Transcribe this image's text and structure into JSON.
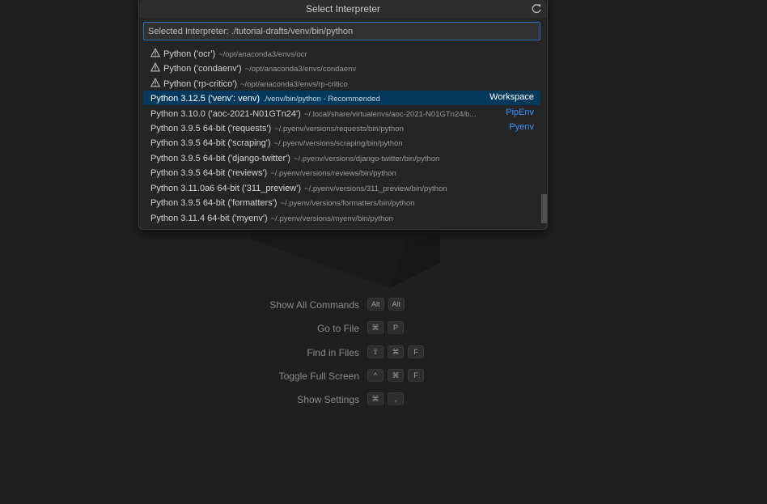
{
  "quick_pick": {
    "title": "Select Interpreter",
    "input_value": "Selected Interpreter: ./tutorial-drafts/venv/bin/python",
    "items": [
      {
        "label": "Python ('ocr')",
        "description": "~/opt/anaconda3/envs/ocr",
        "badge": "",
        "warning": true
      },
      {
        "label": "Python ('condaenv')",
        "description": "~/opt/anaconda3/envs/condaenv",
        "badge": "",
        "warning": true
      },
      {
        "label": "Python ('rp-critico')",
        "description": "~/opt/anaconda3/envs/rp-critico",
        "badge": "",
        "warning": true
      },
      {
        "label": "Python 3.12.5 ('venv': venv)",
        "description": "./venv/bin/python - Recommended",
        "badge": "Workspace",
        "warning": false,
        "selected": true
      },
      {
        "label": "Python 3.10.0 ('aoc-2021-N01GTn24')",
        "description": "~/.local/share/virtualenvs/aoc-2021-N01GTn24/b...",
        "badge": "PipEnv",
        "warning": false
      },
      {
        "label": "Python 3.9.5 64-bit ('requests')",
        "description": "~/.pyenv/versions/requests/bin/python",
        "badge": "Pyenv",
        "warning": false
      },
      {
        "label": "Python 3.9.5 64-bit ('scraping')",
        "description": "~/.pyenv/versions/scraping/bin/python",
        "badge": "",
        "warning": false
      },
      {
        "label": "Python 3.9.5 64-bit ('django-twitter')",
        "description": "~/.pyenv/versions/django-twitter/bin/python",
        "badge": "",
        "warning": false
      },
      {
        "label": "Python 3.9.5 64-bit ('reviews')",
        "description": "~/.pyenv/versions/reviews/bin/python",
        "badge": "",
        "warning": false
      },
      {
        "label": "Python 3.11.0a6 64-bit ('311_preview')",
        "description": "~/.pyenv/versions/311_preview/bin/python",
        "badge": "",
        "warning": false
      },
      {
        "label": "Python 3.9.5 64-bit ('formatters')",
        "description": "~/.pyenv/versions/formatters/bin/python",
        "badge": "",
        "warning": false
      },
      {
        "label": "Python 3.11.4 64-bit ('myenv')",
        "description": "~/.pyenv/versions/myenv/bin/python",
        "badge": "",
        "warning": false
      }
    ]
  },
  "shortcuts": [
    {
      "label": "Show All Commands",
      "keys": [
        "Alt",
        "Alt"
      ]
    },
    {
      "label": "Go to File",
      "keys": [
        "⌘",
        "P"
      ]
    },
    {
      "label": "Find in Files",
      "keys": [
        "⇧",
        "⌘",
        "F"
      ]
    },
    {
      "label": "Toggle Full Screen",
      "keys": [
        "^",
        "⌘",
        "F"
      ]
    },
    {
      "label": "Show Settings",
      "keys": [
        "⌘",
        ","
      ]
    }
  ],
  "colors": {
    "selection": "#04395e",
    "badge": "#3794ff",
    "focus_border": "#2b6fb3"
  }
}
